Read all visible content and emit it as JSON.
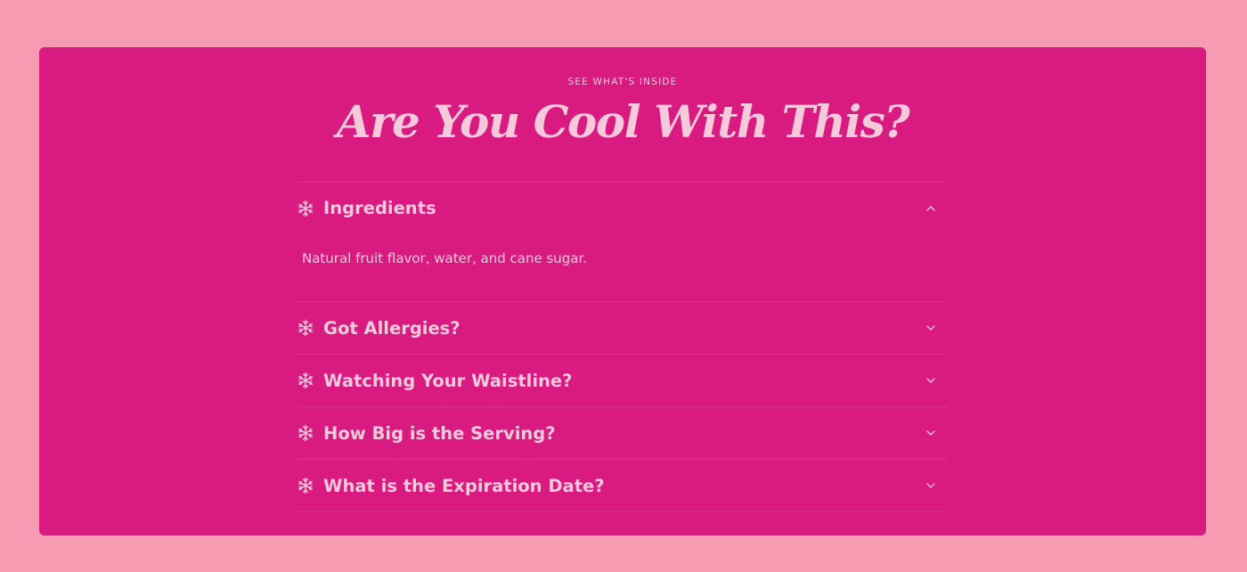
{
  "section": {
    "eyebrow": "SEE WHAT'S INSIDE",
    "title": "Are You Cool With This?"
  },
  "faq": {
    "items": [
      {
        "question": "Ingredients",
        "answer": "Natural fruit flavor, water, and cane sugar.",
        "expanded": true,
        "icon": "snowflake-icon"
      },
      {
        "question": "Got Allergies?",
        "expanded": false,
        "icon": "snowflake-icon"
      },
      {
        "question": "Watching Your Waistline?",
        "expanded": false,
        "icon": "snowflake-icon"
      },
      {
        "question": "How Big is the Serving?",
        "expanded": false,
        "icon": "snowflake-icon"
      },
      {
        "question": "What is the Expiration Date?",
        "expanded": false,
        "icon": "snowflake-icon"
      }
    ]
  },
  "colors": {
    "page_bg": "#f69bb2",
    "card_bg": "#d91a80",
    "text": "#f7c9da"
  }
}
